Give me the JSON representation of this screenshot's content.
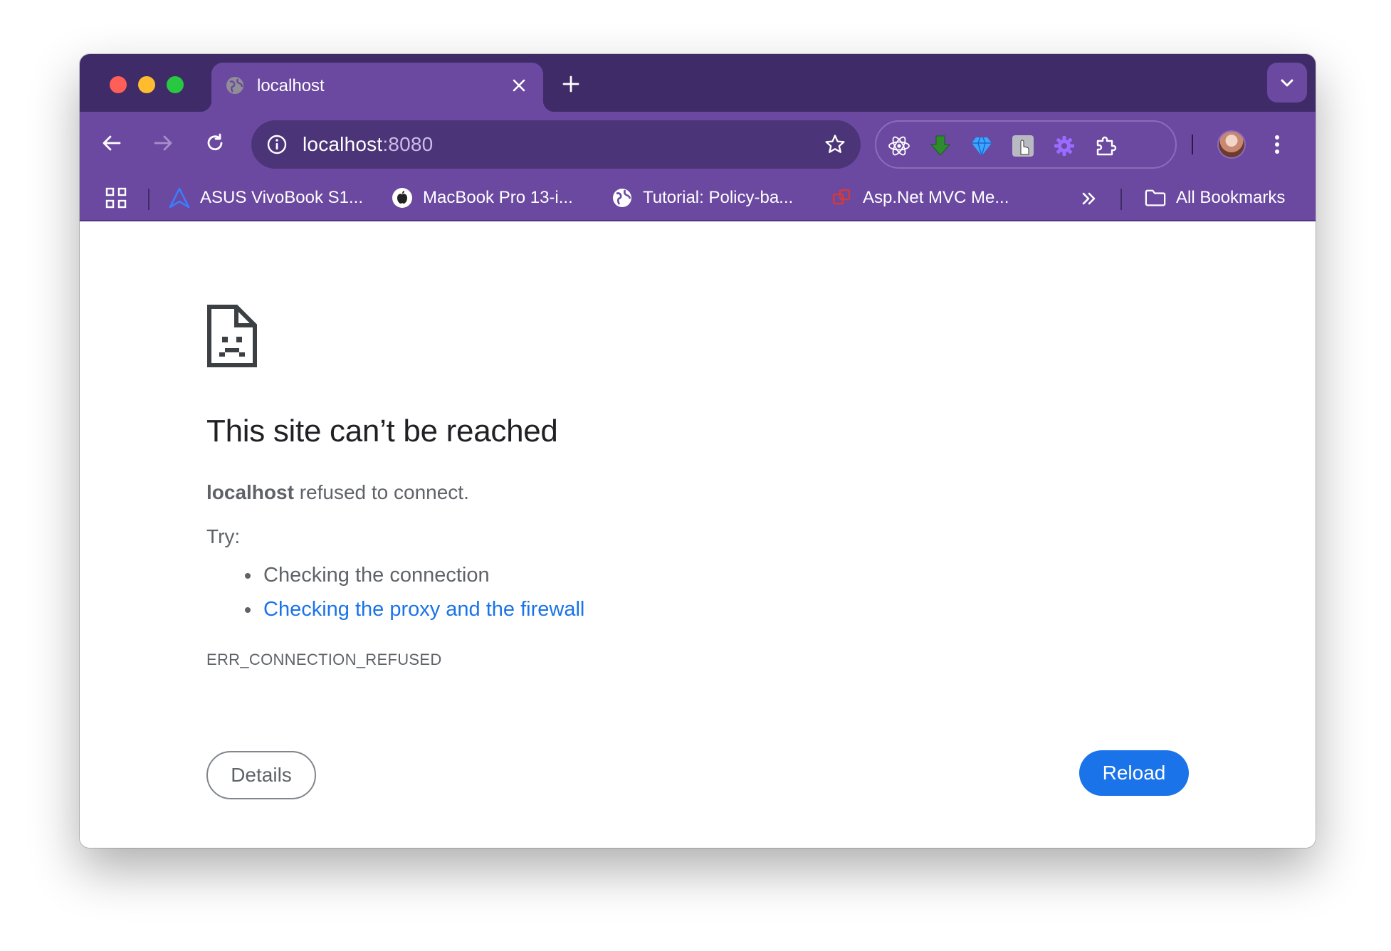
{
  "window": {
    "tab": {
      "title": "localhost",
      "favicon": "globe-icon"
    },
    "new_tab_icon": "plus-icon",
    "tab_search_icon": "chevron-down-icon"
  },
  "toolbar": {
    "back_icon": "arrow-left-icon",
    "forward_icon": "arrow-right-icon",
    "reload_icon": "reload-icon",
    "omnibox": {
      "host": "localhost",
      "port": ":8080",
      "info_icon": "info-icon",
      "bookmark_icon": "star-icon"
    },
    "extensions": [
      "react-devtools-icon",
      "download-arrow-icon",
      "gem-icon",
      "hand-cursor-icon",
      "gear-icon",
      "puzzle-icon"
    ],
    "profile_icon": "avatar",
    "menu_icon": "kebab-menu-icon"
  },
  "bookmarks": {
    "items": [
      {
        "label": "ASUS VivoBook S1...",
        "icon": "asus-logo-icon"
      },
      {
        "label": "MacBook Pro 13-i...",
        "icon": "apple-logo-icon"
      },
      {
        "label": "Tutorial: Policy-ba...",
        "icon": "globe-icon"
      },
      {
        "label": "Asp.Net MVC Me...",
        "icon": "red-squares-icon"
      }
    ],
    "all_bookmarks_label": "All Bookmarks",
    "overflow_icon": "double-chevron-icon"
  },
  "error": {
    "title": "This site can’t be reached",
    "host": "localhost",
    "message": " refused to connect.",
    "try_label": "Try:",
    "suggestions": [
      "Checking the connection",
      "Checking the proxy and the firewall"
    ],
    "code": "ERR_CONNECTION_REFUSED",
    "details_label": "Details",
    "reload_label": "Reload"
  },
  "colors": {
    "frame": "#3f2b68",
    "toolbar": "#6b49a0",
    "link": "#1a73e8",
    "primary_button": "#1a73e8",
    "text_secondary": "#5f6368"
  }
}
